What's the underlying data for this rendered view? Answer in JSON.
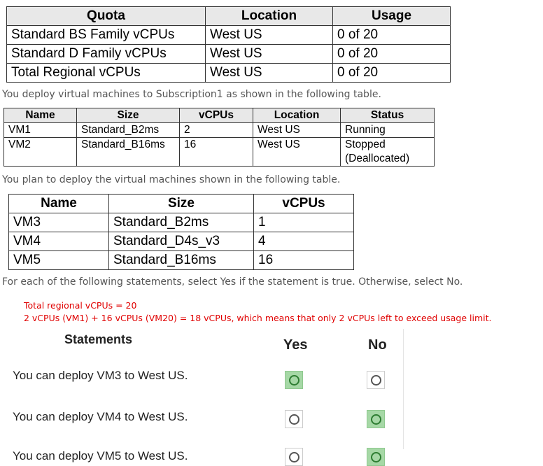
{
  "quota_table": {
    "headers": [
      "Quota",
      "Location",
      "Usage"
    ],
    "rows": [
      [
        "Standard BS Family vCPUs",
        "West US",
        "0 of 20"
      ],
      [
        "Standard D Family vCPUs",
        "West US",
        "0 of 20"
      ],
      [
        "Total Regional vCPUs",
        "West US",
        "0 of 20"
      ]
    ]
  },
  "note1": "You deploy virtual machines to Subscription1 as shown in the following table.",
  "deployed_table": {
    "headers": [
      "Name",
      "Size",
      "vCPUs",
      "Location",
      "Status"
    ],
    "rows": [
      [
        "VM1",
        "Standard_B2ms",
        "2",
        "West US",
        "Running"
      ],
      [
        "VM2",
        "Standard_B16ms",
        "16",
        "West US",
        "Stopped\n(Deallocated)"
      ]
    ]
  },
  "note2": "You plan to deploy the virtual machines shown in the following table.",
  "planned_table": {
    "headers": [
      "Name",
      "Size",
      "vCPUs"
    ],
    "rows": [
      [
        "VM3",
        "Standard_B2ms",
        "1"
      ],
      [
        "VM4",
        "Standard_D4s_v3",
        "4"
      ],
      [
        "VM5",
        "Standard_B16ms",
        "16"
      ]
    ]
  },
  "note3": "For each of the following statements, select Yes if the statement is true. Otherwise, select No.",
  "explanation": {
    "line1": "Total regional vCPUs = 20",
    "line2": "2 vCPUs (VM1) + 16 vCPUs (VM20) = 18 vCPUs, which means that only 2 vCPUs left to exceed usage limit."
  },
  "statements": {
    "header": "Statements",
    "yes_label": "Yes",
    "no_label": "No",
    "items": [
      {
        "text": "You can deploy VM3 to West US.",
        "answer": "Yes"
      },
      {
        "text": "You can deploy VM4 to West US.",
        "answer": "No"
      },
      {
        "text": "You can deploy VM5 to West US.",
        "answer": "No"
      }
    ]
  },
  "colors": {
    "selected": "#a6d8a6",
    "explanation_text": "#e00000"
  },
  "icons": [
    "radio-button-icon"
  ]
}
